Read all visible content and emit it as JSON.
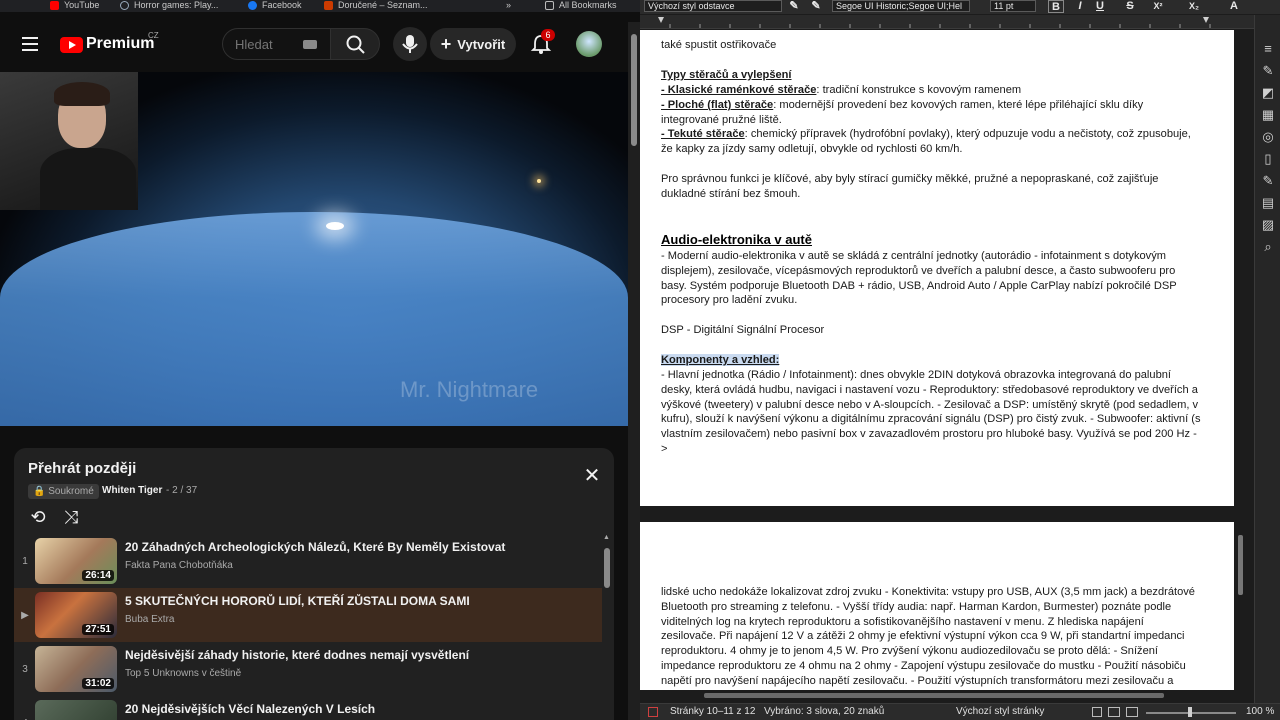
{
  "bookmarks": {
    "items": [
      "YouTube",
      "Horror games: Play...",
      "Facebook",
      "Doručené – Seznam...",
      "All Bookmarks"
    ],
    "overflow": "»"
  },
  "youtube": {
    "brand": "Premium",
    "country": "CZ",
    "search": {
      "placeholder": "Hledat"
    },
    "create_label": "Vytvořit",
    "notif_count": "6",
    "video": {
      "watermark": "Mr. Nightmare"
    },
    "playlist": {
      "title": "Přehrát později",
      "privacy": "Soukromé",
      "owner": "Whiten Tiger",
      "position": "- 2 / 37",
      "items": [
        {
          "index": "1",
          "title": "20 Záhadných Archeologických Nálezů, Které By Neměly Existovat",
          "channel": "Fakta Pana Chobotňáka",
          "duration": "26:14",
          "active": false
        },
        {
          "index": "▶",
          "title": "5 SKUTEČNÝCH HORORŮ LIDÍ, KTEŘÍ ZŮSTALI DOMA SAMI",
          "channel": "Buba Extra",
          "duration": "27:51",
          "active": true
        },
        {
          "index": "3",
          "title": "Nejděsivější záhady historie, které dodnes nemají vysvětlení",
          "channel": "Top 5 Unknowns v češtině",
          "duration": "31:02",
          "active": false
        },
        {
          "index": "4",
          "title": "20 Nejděsivějších Věcí Nalezených V Lesích",
          "channel": "",
          "duration": "",
          "active": false
        }
      ]
    }
  },
  "writer": {
    "toolbar": {
      "para_style": "Výchozí styl odstavce",
      "font_name": "Segoe UI Historic;Segoe UI;Hel",
      "font_size": "11 pt",
      "bold": "B",
      "italic": "I",
      "underline": "U",
      "strike": "S",
      "superscript": "X²",
      "subscript": "X₂",
      "char_a": "A"
    },
    "page1": {
      "l_intro": "také spustit ostřikovače",
      "h_types": "Typy stěračů a vylepšení",
      "l_types1_b": "- Klasické raménkové stěrače",
      "l_types1": ": tradiční konstrukce s kovovým ramenem",
      "l_types2_b": "- Ploché (flat) stěrače",
      "l_types2": ": modernější provedení bez kovových ramen, které lépe přiléhající sklu díky integrované pružné liště.",
      "l_types3_b": "- Tekuté stěrače",
      "l_types3": ": chemický přípravek (hydrofóbní povlaky), který odpuzuje vodu a nečistoty, což zpusobuje, že kapky za jízdy samy odletují, obvykle od rychlosti 60 km/h.",
      "l_correct": "Pro správnou funkci je klíčové, aby byly stírací gumičky měkké, pružné a nepopraskané, což zajišťuje dukladné stírání bez šmouh.",
      "h_audio": "Audio-elektronika v autě",
      "l_audio": "- Moderní audio-elektronika v autě se skládá z centrální jednotky (autorádio - infotainment s dotykovým displejem), zesilovače, vícepásmových reproduktorů ve dveřích a palubní desce, a často subwooferu pro basy. Systém podporuje Bluetooth DAB + rádio, USB, Android Auto / Apple CarPlay nabízí pokročilé DSP procesory pro ladění zvuku.",
      "l_dsp": "DSP - Digitální Signální Procesor",
      "h_comp": "Komponenty a vzhled:",
      "l_comp": "- Hlavní jednotka (Rádio / Infotainment): dnes obvykle 2DIN dotyková obrazovka integrovaná do palubní desky, která ovládá hudbu, navigaci i nastavení vozu - Reproduktory: středobasové reproduktory ve dveřích a výškové (tweetery) v palubní desce nebo v A-sloupcích. - Zesilovač a DSP: umístěný skrytě (pod sedadlem, v kufru), slouží k navýšení výkonu a digitálnímu zpracování signálu (DSP) pro čistý zvuk. - Subwoofer: aktivní (s vlastním zesilovačem) nebo pasivní box v zavazadlovém prostoru pro hluboké basy. Využívá se pod 200 Hz ->"
    },
    "page2": {
      "text": "lidské ucho nedokáže lokalizovat zdroj zvuku - Konektivita: vstupy pro USB, AUX (3,5 mm jack) a bezdrátové Bluetooth pro streaming z telefonu. - Vyšší třídy audia: např. Harman Kardon, Burmester) poznáte podle viditelných log na krytech reproduktoru a sofistikovanějšího nastavení v menu. Z hlediska napájení zesilovače. Při napájení 12 V a zátěži 2 ohmy je efektivní výstupní výkon cca 9 W, při standartní impedanci reproduktoru. 4 ohmy je to jenom 4,5 W. Pro zvýšení výkonu audiozedilovaču se proto dělá: - Snížení impedance reproduktoru ze 4 ohmu na 2 ohmy - Zapojení výstupu zesilovače do mustku - Použití násobiču napětí pro navýšení napájecího napětí zesilovaču. - Použití výstupních transformátoru mezi zesilovaču a reproduktory -"
    },
    "status": {
      "pages": "Stránky 10–11 z 12",
      "selected": "Vybráno: 3 slova, 20 znaků",
      "page_style": "Výchozí styl stránky",
      "zoom": "100 %"
    }
  }
}
